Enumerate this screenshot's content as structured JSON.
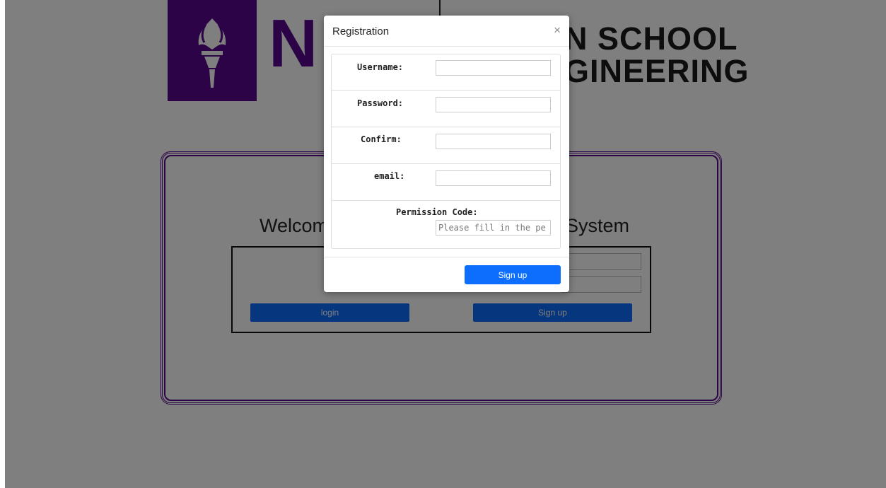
{
  "background": {
    "logo": {
      "letter": "N",
      "text_line1": "N SCHOOL",
      "text_line2": "GINEERING"
    },
    "welcome_left": "Welcom",
    "welcome_right": "System",
    "buttons": {
      "login_label": "login",
      "signup_label": "Sign up"
    }
  },
  "modal": {
    "title": "Registration",
    "close_label": "×",
    "fields": {
      "username_label": "Username:",
      "password_label": "Password:",
      "confirm_label": "Confirm:",
      "email_label": "email:",
      "permission_label": "Permission Code:",
      "permission_placeholder": "Please fill in the pe"
    },
    "signup_label": "Sign up"
  },
  "colors": {
    "brand_purple": "#57068c",
    "button_blue": "#0d6efd",
    "backdrop": "rgba(0,0,0,0.5)"
  }
}
